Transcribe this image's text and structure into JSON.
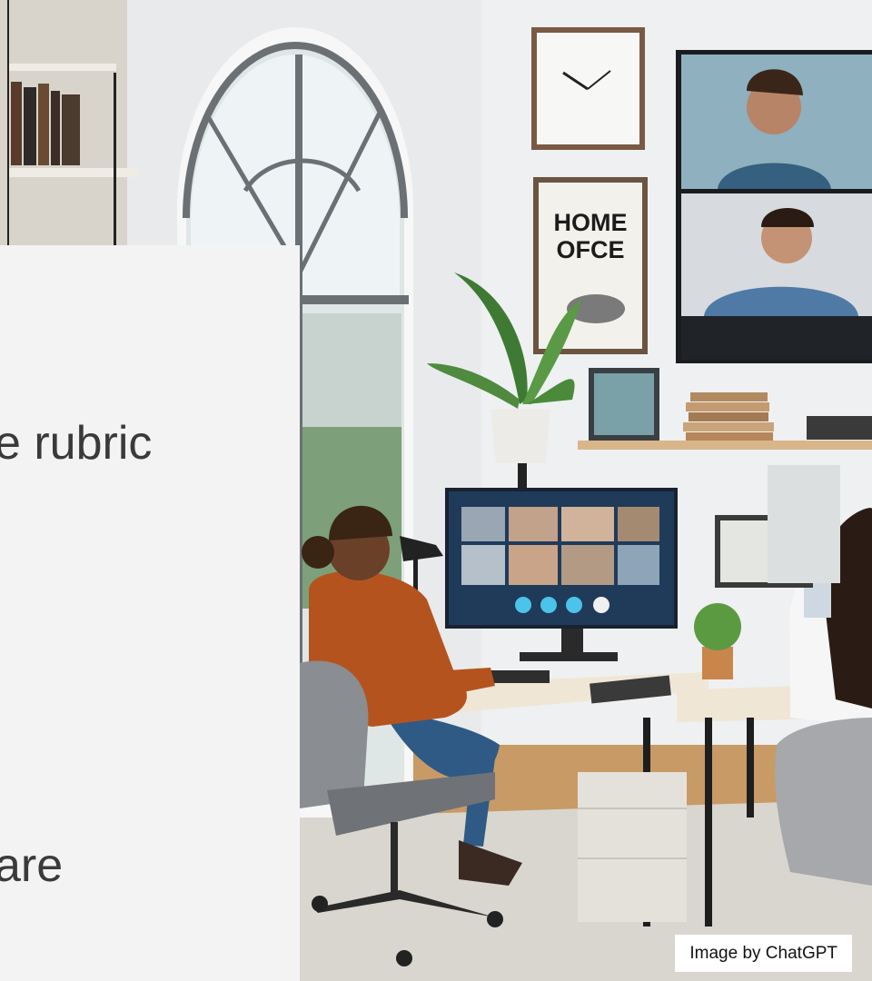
{
  "slide": {
    "text_line_1": "e rubric",
    "text_line_2": "are"
  },
  "photo": {
    "wall_poster": [
      "HOME",
      "OFCE"
    ],
    "caption": "Image by ChatGPT"
  },
  "colors": {
    "slide_background": "#f3f3f3",
    "slide_text": "#3a3a3a",
    "caption_background": "#ffffff"
  }
}
